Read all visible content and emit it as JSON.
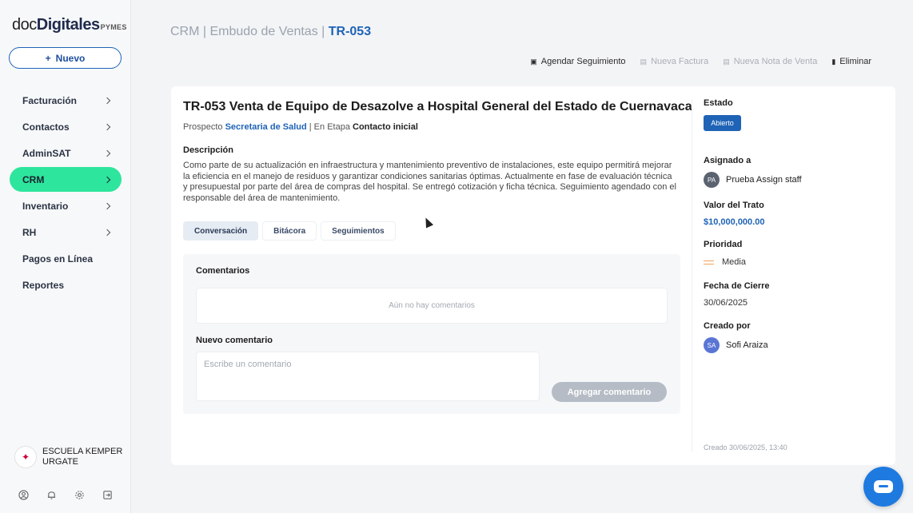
{
  "brand": {
    "part1": "doc",
    "part2": "Digitales",
    "suffix": "PYMES"
  },
  "sidebar": {
    "new_button": "Nuevo",
    "items": [
      {
        "label": "Facturación",
        "has_chevron": true,
        "active": false
      },
      {
        "label": "Contactos",
        "has_chevron": true,
        "active": false
      },
      {
        "label": "AdminSAT",
        "has_chevron": true,
        "active": false
      },
      {
        "label": "CRM",
        "has_chevron": true,
        "active": true
      },
      {
        "label": "Inventario",
        "has_chevron": true,
        "active": false
      },
      {
        "label": "RH",
        "has_chevron": true,
        "active": false
      },
      {
        "label": "Pagos en Línea",
        "has_chevron": false,
        "active": false
      },
      {
        "label": "Reportes",
        "has_chevron": false,
        "active": false
      }
    ],
    "org": {
      "line1": "ESCUELA KEMPER",
      "line2": "URGATE"
    },
    "bottom_icons": [
      "user-circle-icon",
      "bell-icon",
      "gear-icon",
      "logout-icon"
    ]
  },
  "header": {
    "breadcrumb": {
      "part1": "CRM",
      "sep": " | ",
      "part2": "Embudo de Ventas",
      "current": "TR-053"
    },
    "actions": [
      {
        "label": "Agendar Seguimiento",
        "icon": "calendar-icon",
        "enabled": true
      },
      {
        "label": "Nueva Factura",
        "icon": "invoice-icon",
        "enabled": false
      },
      {
        "label": "Nueva Nota de Venta",
        "icon": "note-icon",
        "enabled": false
      },
      {
        "label": "Eliminar",
        "icon": "trash-icon",
        "enabled": true
      }
    ]
  },
  "deal": {
    "title": "TR-053  Venta de Equipo de Desazolve a Hospital General del Estado de Cuernavaca",
    "prospect_prefix": "Prospecto",
    "prospect_name": "Secretaria de Salud",
    "stage_prefix": "| En Etapa",
    "stage": "Contacto inicial",
    "description_label": "Descripción",
    "description": "Como parte de su actualización en infraestructura y mantenimiento preventivo de instalaciones, este equipo permitirá mejorar la eficiencia en el manejo de residuos y garantizar condiciones sanitarias óptimas. Actualmente en fase de evaluación técnica y presupuestal por parte del área de compras del hospital. Se entregó cotización y ficha técnica. Seguimiento agendado con el responsable del área de mantenimiento.",
    "tabs": [
      {
        "label": "Conversación",
        "active": true
      },
      {
        "label": "Bitácora",
        "active": false
      },
      {
        "label": "Seguimientos",
        "active": false
      }
    ],
    "comments_label": "Comentarios",
    "empty_comments": "Aún no hay comentarios",
    "new_comment_label": "Nuevo comentario",
    "comment_placeholder": "Escribe un comentario",
    "add_comment_button": "Agregar comentario"
  },
  "details": {
    "status_label": "Estado",
    "status": "Abierto",
    "assigned_label": "Asignado a",
    "assigned_initials": "PA",
    "assigned_name": "Prueba Assign staff",
    "value_label": "Valor del Trato",
    "value": "$10,000,000.00",
    "priority_label": "Prioridad",
    "priority": "Media",
    "close_date_label": "Fecha de Cierre",
    "close_date": "30/06/2025",
    "created_by_label": "Creado por",
    "created_by_initials": "SA",
    "created_by_name": "Sofi Araiza",
    "created_ts": "Creado 30/06/2025, 13:40"
  },
  "colors": {
    "accent": "#1f63b6",
    "active_nav": "#2ee59d",
    "priority": "#f0a15a",
    "chat": "#1f7ae0"
  }
}
